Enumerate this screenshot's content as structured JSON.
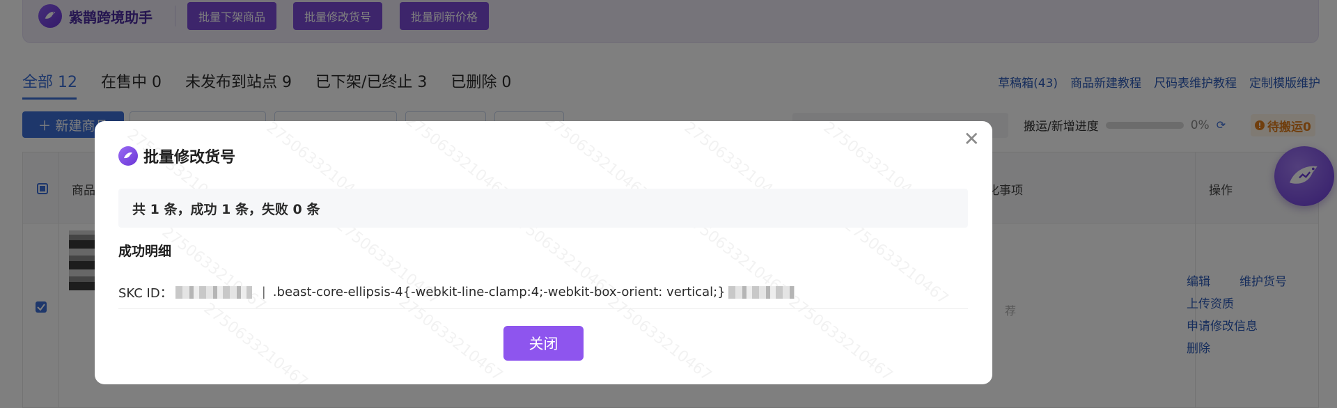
{
  "app": {
    "brand_name": "紫鹊跨境助手",
    "toolbar": {
      "batch_delist": "批量下架商品",
      "batch_edit_sku": "批量修改货号",
      "batch_refresh_price": "批量刷新价格"
    }
  },
  "tabs": [
    {
      "label": "全部 12"
    },
    {
      "label": "在售中 0"
    },
    {
      "label": "未发布到站点 9"
    },
    {
      "label": "已下架/已终止 3"
    },
    {
      "label": "已删除 0"
    }
  ],
  "top_links": [
    "草稿箱(43)",
    "商品新建教程",
    "尺码表维护教程",
    "定制模版维护"
  ],
  "new_product_button": "新建商品",
  "progress": {
    "label": "搬运/新增进度",
    "percent_text": "0%",
    "percent": 0
  },
  "pending_label": "待搬运0",
  "table": {
    "col_product": "商品",
    "col_optimize": "化事项",
    "col_actions": "操作",
    "row_status_text": "荐",
    "row_actions": [
      "编辑",
      "维护货号",
      "上传资质",
      "申请修改信息",
      "删除"
    ]
  },
  "watermark_text": "2750633210467",
  "modal": {
    "title": "批量修改货号",
    "summary": "共 1 条，成功 1 条，失败 0 条",
    "section_title": "成功明细",
    "detail_prefix": "SKC ID：",
    "detail_sep": "|",
    "detail_text": ".beast-core-ellipsis-4{-webkit-line-clamp:4;-webkit-box-orient: vertical;}",
    "close_label": "关闭"
  },
  "colors": {
    "brand_purple": "#7a4ad6",
    "primary_blue": "#3d6fd6",
    "close_button": "#8e55ee",
    "pending_orange": "#e07c1a"
  }
}
